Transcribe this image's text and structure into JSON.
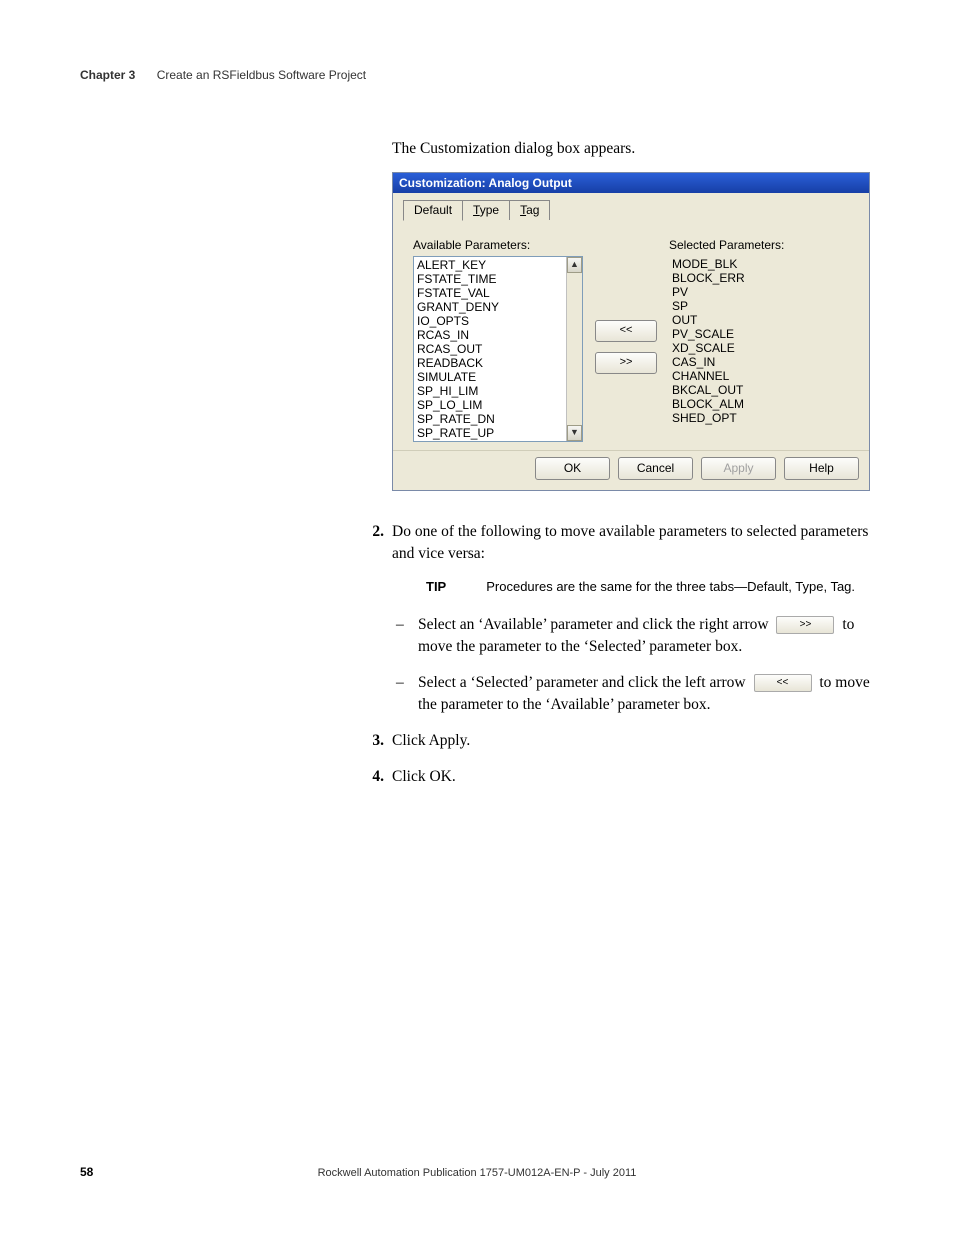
{
  "header": {
    "chapter": "Chapter 3",
    "title": "Create an RSFieldbus Software Project"
  },
  "intro": "The Customization dialog box appears.",
  "dialog": {
    "title": "Customization: Analog Output",
    "tabs": {
      "default": "Default",
      "type_u": "T",
      "type_rest": "ype",
      "tag_u": "T",
      "tag_rest": "ag"
    },
    "available_label": "Available Parameters:",
    "selected_label": "Selected Parameters:",
    "available": [
      "ALERT_KEY",
      "FSTATE_TIME",
      "FSTATE_VAL",
      "GRANT_DENY",
      "IO_OPTS",
      "RCAS_IN",
      "RCAS_OUT",
      "READBACK",
      "SIMULATE",
      "SP_HI_LIM",
      "SP_LO_LIM",
      "SP_RATE_DN",
      "SP_RATE_UP"
    ],
    "selected": [
      "MODE_BLK",
      "BLOCK_ERR",
      "PV",
      "SP",
      "OUT",
      "PV_SCALE",
      "XD_SCALE",
      "CAS_IN",
      "CHANNEL",
      "BKCAL_OUT",
      "BLOCK_ALM",
      "SHED_OPT"
    ],
    "btn_left": "<<",
    "btn_right": ">>",
    "ok": "OK",
    "cancel": "Cancel",
    "apply": "Apply",
    "help": "Help"
  },
  "steps": {
    "s2_num": "2.",
    "s2": "Do one of the following to move available parameters to selected parameters and vice versa:",
    "tip_label": "TIP",
    "tip_text": "Procedures are the same for the three tabs—Default, Type, Tag.",
    "b1a": "Select an ‘Available’ parameter and click the right arrow",
    "b1_icon": ">>",
    "b1b": "to move the parameter to the ‘Selected’ parameter box.",
    "b2a": "Select a ‘Selected’ parameter and click the left arrow",
    "b2_icon": "<<",
    "b2b": "to move the parameter to the ‘Available’ parameter box.",
    "s3_num": "3.",
    "s3": "Click Apply.",
    "s4_num": "4.",
    "s4": "Click OK."
  },
  "footer": {
    "page": "58",
    "pub": "Rockwell Automation Publication 1757-UM012A-EN-P - July 2011"
  }
}
